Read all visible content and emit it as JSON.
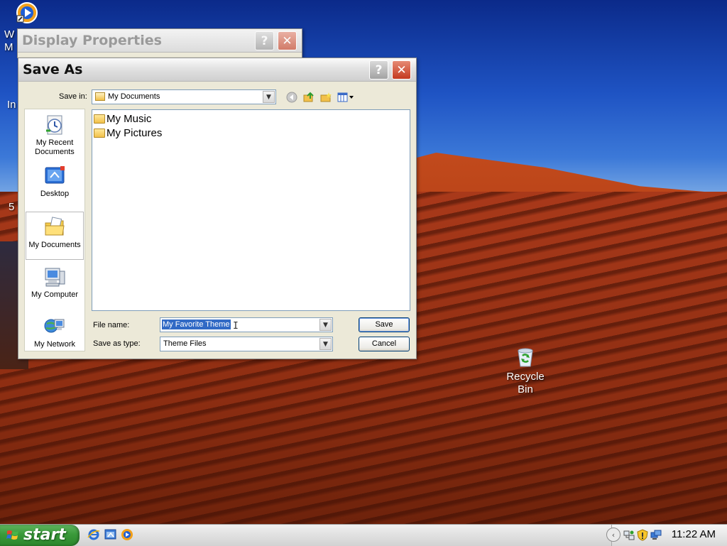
{
  "desktop": {
    "icons": [
      {
        "label": "Recycle Bin",
        "line1": "Recycle",
        "line2": "Bin"
      }
    ],
    "partial_labels": [
      "W",
      "M",
      "In",
      "5"
    ]
  },
  "display_properties": {
    "title": "Display Properties",
    "help_glyph": "?",
    "close_glyph": "✕"
  },
  "save_as": {
    "title": "Save As",
    "help_glyph": "?",
    "close_glyph": "✕",
    "save_in_label": "Save in:",
    "save_in_value": "My Documents",
    "places": [
      {
        "line1": "My Recent",
        "line2": "Documents"
      },
      {
        "line1": "Desktop",
        "line2": ""
      },
      {
        "line1": "My Documents",
        "line2": ""
      },
      {
        "line1": "My Computer",
        "line2": ""
      },
      {
        "line1": "My Network",
        "line2": ""
      }
    ],
    "files": [
      "My Music",
      "My Pictures"
    ],
    "file_name_label": "File name:",
    "file_name_value": "My Favorite Theme",
    "save_as_type_label": "Save as type:",
    "save_as_type_value": "Theme Files",
    "save_button": "Save",
    "cancel_button": "Cancel"
  },
  "taskbar": {
    "start_label": "start",
    "clock": "11:22 AM"
  },
  "colors": {
    "start_green": "#3a9a3a",
    "close_red": "#c4391f",
    "selection_blue": "#316ac5"
  }
}
